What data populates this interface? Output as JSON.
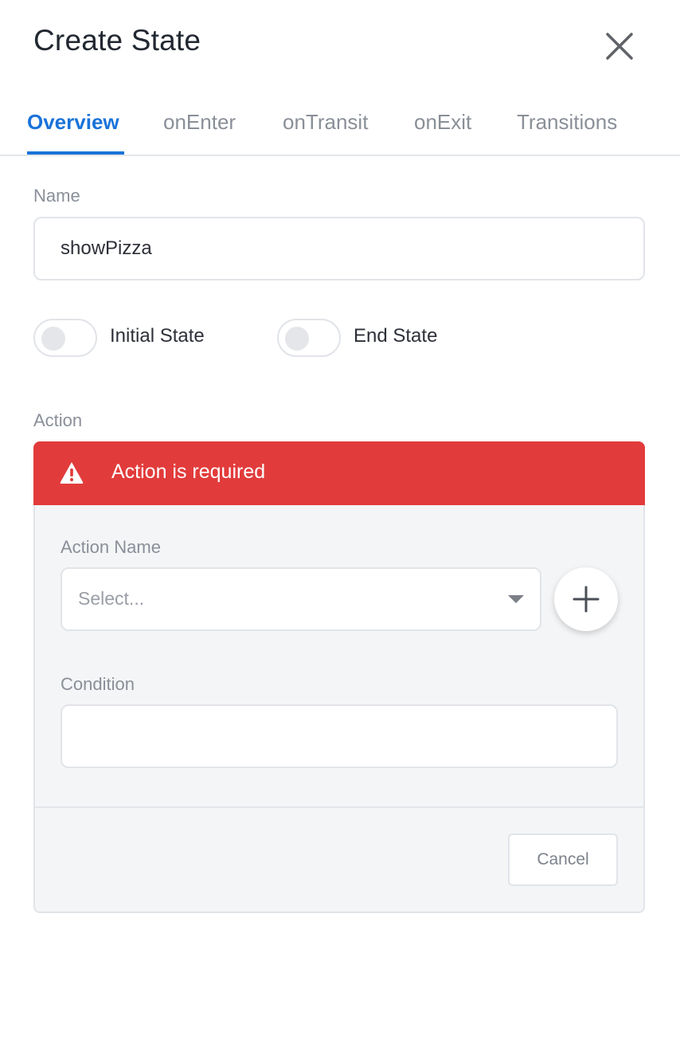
{
  "header": {
    "title": "Create State",
    "close_icon": "close-icon"
  },
  "tabs": [
    {
      "label": "Overview",
      "active": true
    },
    {
      "label": "onEnter",
      "active": false
    },
    {
      "label": "onTransit",
      "active": false
    },
    {
      "label": "onExit",
      "active": false
    },
    {
      "label": "Transitions",
      "active": false
    }
  ],
  "form": {
    "name_label": "Name",
    "name_value": "showPizza",
    "initial_state": {
      "label": "Initial State",
      "on": false
    },
    "end_state": {
      "label": "End State",
      "on": false
    },
    "action_label": "Action"
  },
  "alert": {
    "message": "Action is required",
    "icon": "warning-icon",
    "color": "#e23b3b"
  },
  "action_panel": {
    "action_name_label": "Action Name",
    "action_name_placeholder": "Select...",
    "add_icon": "plus-icon",
    "condition_label": "Condition",
    "condition_value": "",
    "cancel_label": "Cancel"
  },
  "colors": {
    "accent": "#1a73d9",
    "error": "#e23b3b"
  }
}
